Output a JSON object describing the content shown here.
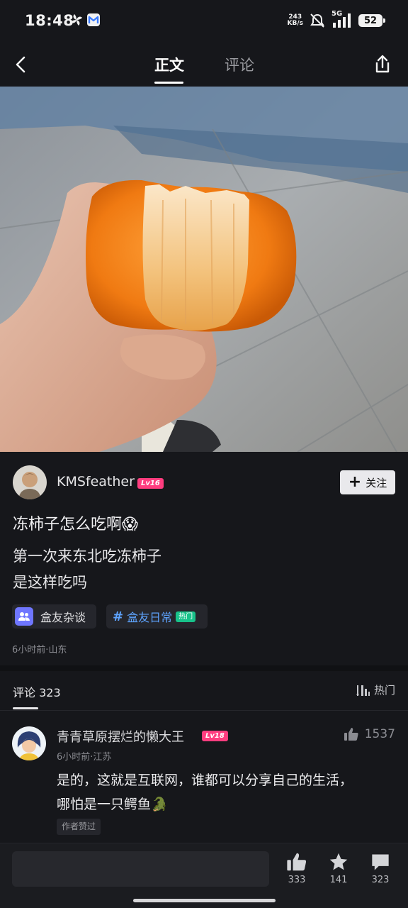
{
  "status_bar": {
    "time": "18:48",
    "net_speed_value": "243",
    "net_speed_unit": "KB/s",
    "net_type": "5G",
    "battery": "52",
    "icons": [
      "fan-icon",
      "mail-app-icon",
      "mute-icon",
      "signal-icon",
      "battery-icon"
    ]
  },
  "nav": {
    "tab_main": "正文",
    "tab_comments": "评论",
    "icons": [
      "back-arrow-icon",
      "share-icon"
    ]
  },
  "post": {
    "author": {
      "name": "KMSfeather",
      "level": "Lv16",
      "follow_label": "关注"
    },
    "title": "冻柿子怎么吃啊😱",
    "body_lines": [
      "第一次来东北吃冻柿子",
      "是这样吃吗"
    ],
    "tags": [
      {
        "label": "盒友杂谈",
        "icon": "group-icon"
      },
      {
        "label": "盒友日常",
        "badge": "热门",
        "icon": "hash-icon"
      }
    ],
    "meta": "6小时前·山东"
  },
  "comments": {
    "header_label": "评论 323",
    "sort_label": "热门",
    "items": [
      {
        "name": "青青草原摆烂的懒大王",
        "level": "Lv18",
        "likes": "1537",
        "meta": "6小时前·江苏",
        "text_lines": [
          "是的，这就是互联网，谁都可以分享自己的生活，",
          "哪怕是一只鳄鱼🐊"
        ],
        "author_liked": "作者赞过"
      }
    ]
  },
  "bottom_bar": {
    "input_placeholder": "",
    "likes": "333",
    "favorites": "141",
    "comments": "323"
  },
  "colors": {
    "background": "#16171b",
    "level_badge": "#ff3d7f",
    "tag_accent": "#5ea4ff",
    "hot_badge": "#18c28a",
    "persimmon": "#f07a12"
  }
}
